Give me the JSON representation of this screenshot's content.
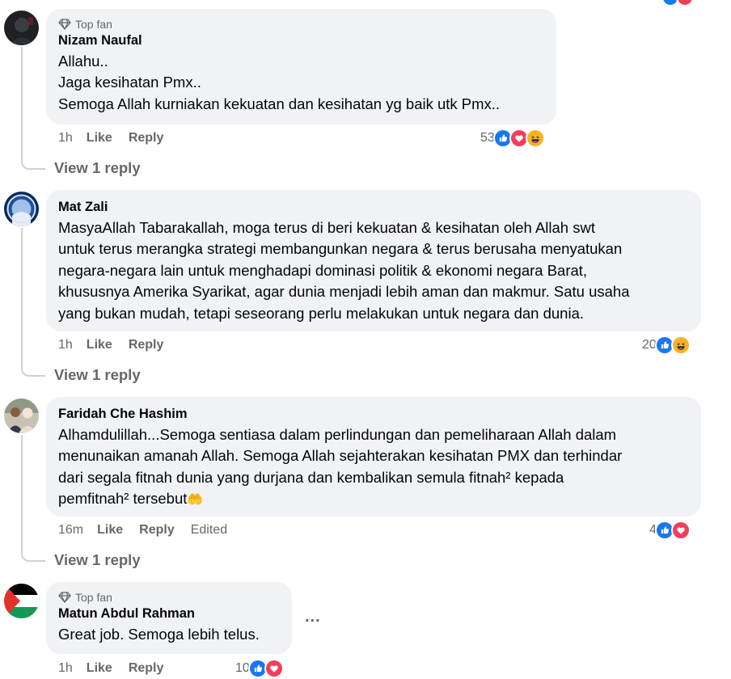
{
  "comments": [
    {
      "badge": "Top fan",
      "name": "Nizam Naufal",
      "lines": [
        "Allahu..",
        "Jaga kesihatan Pmx..",
        "Semoga Allah kurniakan kekuatan dan kesihatan yg baik utk Pmx.."
      ],
      "time": "1h",
      "like": "Like",
      "reply": "Reply",
      "reaction_count": "53",
      "reactions": [
        "like",
        "love",
        "haha"
      ],
      "view_replies": "View 1 reply"
    },
    {
      "name": "Mat Zali",
      "lines": [
        "MasyaAllah Tabarakallah, moga terus di beri kekuatan & kesihatan oleh Allah swt",
        "untuk terus merangka strategi membangunkan negara & terus berusaha menyatukan",
        "negara-negara lain untuk menghadapi dominasi politik & ekonomi negara Barat,",
        "khususnya Amerika Syarikat, agar dunia menjadi lebih aman dan makmur. Satu usaha",
        "yang bukan mudah, tetapi seseorang perlu melakukan untuk negara dan dunia."
      ],
      "time": "1h",
      "like": "Like",
      "reply": "Reply",
      "reaction_count": "20",
      "reactions": [
        "like",
        "haha"
      ],
      "view_replies": "View 1 reply"
    },
    {
      "name": "Faridah Che Hashim",
      "lines": [
        "Alhamdulillah...Semoga sentiasa dalam perlindungan dan pemeliharaan Allah dalam",
        "menunaikan amanah Allah. Semoga Allah sejahterakan kesihatan PMX dan terhindar",
        "dari segala fitnah dunia yang durjana dan kembalikan semula fitnah² kepada",
        "pemfitnah² tersebut"
      ],
      "emoji": "🤲",
      "time": "16m",
      "like": "Like",
      "reply": "Reply",
      "edited": "Edited",
      "reaction_count": "4",
      "reactions": [
        "like",
        "love"
      ],
      "view_replies": "View 1 reply"
    },
    {
      "badge": "Top fan",
      "name": "Matun Abdul Rahman",
      "lines": [
        "Great job. Semoga lebih telus."
      ],
      "time": "1h",
      "like": "Like",
      "reply": "Reply",
      "reaction_count": "10",
      "reactions": [
        "like",
        "love"
      ],
      "more": "..."
    }
  ],
  "colors": {
    "bubble": "#f0f2f5",
    "secondary_text": "#65676b",
    "like_blue": "#1877f2",
    "love_red": "#f33e58",
    "haha_yellow": "#f7b125"
  }
}
